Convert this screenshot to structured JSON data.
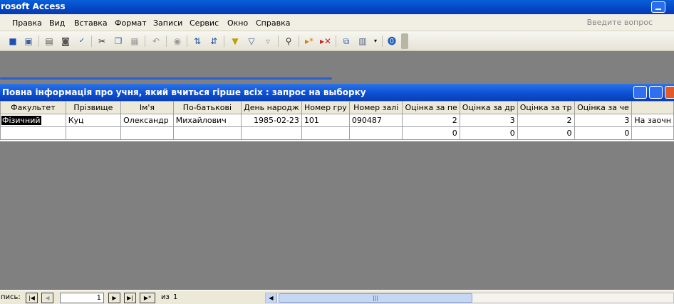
{
  "app": {
    "title": "rosoft Access"
  },
  "menu": {
    "items": [
      "Правка",
      "Вид",
      "Вставка",
      "Формат",
      "Записи",
      "Сервис",
      "Окно",
      "Справка"
    ],
    "help_placeholder": "Введите вопрос"
  },
  "toolbar": {
    "icons": [
      "save-icon",
      "file-search-icon",
      "print-icon",
      "print-preview-icon",
      "spelling-icon",
      "cut-icon",
      "copy-icon",
      "paste-icon",
      "undo-icon",
      "hyperlink-icon",
      "sort-ascending-icon",
      "sort-descending-icon",
      "filter-by-selection-icon",
      "filter-by-form-icon",
      "apply-filter-icon",
      "find-icon",
      "new-record-icon",
      "delete-record-icon",
      "database-window-icon",
      "new-object-icon",
      "help-icon"
    ]
  },
  "query_window": {
    "title": "Повна інформація про учня, який вчиться гірше всіх : запрос на выборку",
    "columns": [
      "Факультет",
      "Прізвище",
      "Ім'я",
      "По-батькові",
      "День народж",
      "Номер гру",
      "Номер залі",
      "Оцінка за пе",
      "Оцінка за др",
      "Оцінка за тр",
      "Оцінка за че",
      ""
    ],
    "rows": [
      [
        "Фізичний",
        "Куц",
        "Олександр",
        "Михайлович",
        "1985-02-23",
        "101",
        "090487",
        "2",
        "3",
        "2",
        "3",
        "На заочн"
      ],
      [
        "",
        "",
        "",
        "",
        "",
        "",
        "",
        "0",
        "0",
        "0",
        "0",
        ""
      ]
    ]
  },
  "status": {
    "record_label": "пись:",
    "current_record": "1",
    "of_label": "из",
    "total_records": "1"
  },
  "colors": {
    "title_blue": "#0a5fd8",
    "grid_header": "#ece9d8",
    "workspace": "#808080"
  }
}
